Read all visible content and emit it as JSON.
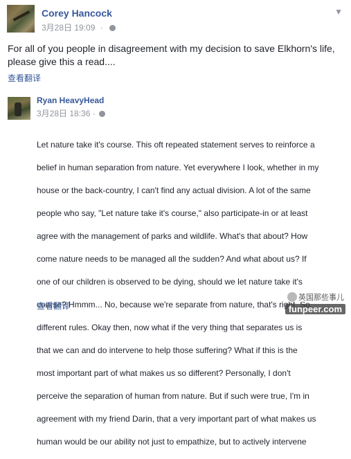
{
  "post": {
    "author": "Corey Hancock",
    "date": "3月28日",
    "time": "19:09",
    "separator": "·",
    "text": "For all of you people in disagreement with my decision to save Elkhorn's life, please give this a read....",
    "translate_label": "查看翻译"
  },
  "shared_post": {
    "author": "Ryan HeavyHead",
    "date": "3月28日",
    "time": "18:36",
    "separator": "·",
    "lines": [
      "Let nature take it's course. This oft repeated statement serves to reinforce a",
      "belief in human separation from nature. Yet everywhere I look, whether in my",
      "house or the back-country, I can't find any actual division. A lot of the same",
      "people who say, \"Let nature take it's course,\" also participate-in or at least",
      "agree with the management of parks and wildlife. What's that about? How",
      "come nature needs to be managed all the sudden? And what about us? If",
      "one of our children is observed to be dying, should we let nature take it's",
      "course? Hmmm... No, because we're separate from nature, that's right. So,",
      "different rules. Okay then, now what if the very thing that separates us is",
      "that we can and do intervene to help those suffering? What if this is the",
      "most important part of what makes us so different? Personally, I don't",
      "perceive the separation of human from nature. But if such were true, I'm in",
      "agreement with my friend Darin, that a very important part of what makes us",
      "human would be our ability not just to empathize, but to actively intervene"
    ],
    "translate_label": "查看翻译"
  },
  "watermark": {
    "label": "英国那些事儿",
    "site": "funpeer.com"
  },
  "icons": {
    "privacy": "globe-icon",
    "options": "chevron-down-icon"
  },
  "colors": {
    "link": "#365899",
    "meta": "#90949c",
    "text": "#1d2129"
  }
}
